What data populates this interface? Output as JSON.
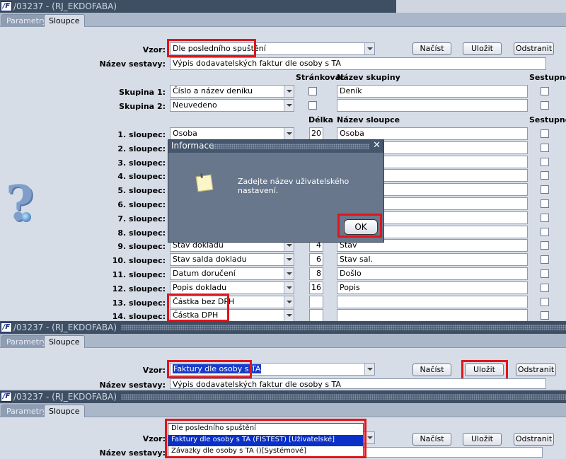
{
  "window1": {
    "title": "/03237 - (RJ_EKDOFABA)",
    "tabs": [
      "Parametry",
      "Sloupce"
    ]
  },
  "window2": {
    "title": "/03237 - (RJ_EKDOFABA)",
    "tabs": [
      "Parametry",
      "Sloupce"
    ]
  },
  "window3": {
    "title": "/03237 - (RJ_EKDOFABA)",
    "tabs": [
      "Parametry",
      "Sloupce"
    ]
  },
  "form1": {
    "vzor_label": "Vzor:",
    "vzor_value": "Dle posledního spuštění",
    "buttons": {
      "nacist": "Načíst",
      "ulozit": "Uložit",
      "odstranit": "Odstranit"
    },
    "nazev_sestavy_label": "Název sestavy:",
    "nazev_sestavy_value": "Výpis dodavatelských faktur dle osoby s TA",
    "hdr_strankovat": "Stránkovat",
    "hdr_nazev_skupiny": "Název skupiny",
    "hdr_sestupne": "Sestupně",
    "hdr_delka": "Délka",
    "hdr_nazev_sloupce": "Název sloupce",
    "groups": [
      {
        "label": "Skupina 1:",
        "value": "Číslo a název deníku",
        "name": "Deník"
      },
      {
        "label": "Skupina 2:",
        "value": "Neuvedeno",
        "name": ""
      }
    ],
    "columns": [
      {
        "label": "1. sloupec:",
        "value": "Osoba",
        "len": "20",
        "name": "Osoba"
      },
      {
        "label": "2. sloupec:",
        "value": "",
        "len": "",
        "name": ""
      },
      {
        "label": "3. sloupec:",
        "value": "",
        "len": "",
        "name": ""
      },
      {
        "label": "4. sloupec:",
        "value": "",
        "len": "",
        "name": ""
      },
      {
        "label": "5. sloupec:",
        "value": "",
        "len": "",
        "name": ""
      },
      {
        "label": "6. sloupec:",
        "value": "",
        "len": "",
        "name": ""
      },
      {
        "label": "7. sloupec:",
        "value": "",
        "len": "",
        "name": ""
      },
      {
        "label": "8. sloupec:",
        "value": "",
        "len": "",
        "name": ""
      },
      {
        "label": "9. sloupec:",
        "value": "Stav dokladu",
        "len": "4",
        "name": "Stav"
      },
      {
        "label": "10. sloupec:",
        "value": "Stav salda dokladu",
        "len": "6",
        "name": "Stav sal."
      },
      {
        "label": "11. sloupec:",
        "value": "Datum doručení",
        "len": "8",
        "name": "Došlo"
      },
      {
        "label": "12. sloupec:",
        "value": "Popis dokladu",
        "len": "16",
        "name": "Popis"
      },
      {
        "label": "13. sloupec:",
        "value": "Částka bez DPH",
        "len": "",
        "name": ""
      },
      {
        "label": "14. sloupec:",
        "value": "Částka DPH",
        "len": "",
        "name": ""
      }
    ]
  },
  "dialog": {
    "title": "Informace",
    "close": "✕",
    "message": "Zadejte název uživatelského nastavení.",
    "ok": "OK"
  },
  "form2": {
    "vzor_label": "Vzor:",
    "vzor_value": "Faktury dle osoby s TA",
    "nacist": "Načíst",
    "ulozit": "Uložit",
    "odstranit": "Odstranit",
    "nazev_sestavy_label": "Název sestavy:",
    "nazev_sestavy_value": "Výpis dodavatelských faktur dle osoby s TA"
  },
  "form3": {
    "vzor_label": "Vzor:",
    "nacist": "Načíst",
    "ulozit": "Uložit",
    "odstranit": "Odstranit",
    "nazev_sestavy_label": "Název sestavy:",
    "dropdown": [
      "Dle posledního spuštění",
      "Faktury dle osoby s TA    (FISTEST)   [Uživatelské]",
      "Závazky dle osoby s TA   ()[Systémové]"
    ]
  }
}
